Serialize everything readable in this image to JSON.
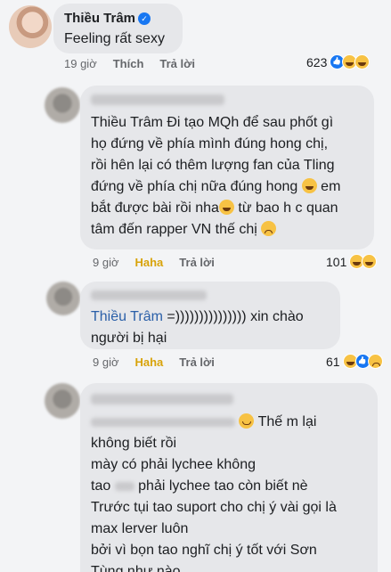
{
  "top_comment": {
    "author": "Thiều Trâm",
    "text": "Feeling rất sexy",
    "time": "19 giờ",
    "like_label": "Thích",
    "reply_label": "Trả lời",
    "reaction_count": "623",
    "reaction_icons": [
      "like-icon",
      "haha-icon",
      "haha-icon"
    ]
  },
  "reply1": {
    "lines": [
      "Thiều Trâm Đi tạo MQh để sau phốt gì",
      "họ đứng về phía mình đúng hong chị,",
      "rồi hên lại có thêm lượng fan của Tling",
      "đứng về phía chị nữa đúng hong",
      "em",
      "bắt được bài rồi nha",
      "từ bao h c quan",
      "tâm đến rapper VN thế chị"
    ],
    "time": "9 giờ",
    "reaction_label": "Haha",
    "reply_label": "Trả lời",
    "reaction_count": "101"
  },
  "reply2": {
    "mention": "Thiều Trâm",
    "line1": " =)))))))))))))))  xin chào",
    "line2": "người bị hại",
    "time": "9 giờ",
    "reaction_label": "Haha",
    "reply_label": "Trả lời",
    "reaction_count": "61"
  },
  "reply3": {
    "line1_tail": "Thế m lại",
    "lines": [
      "không biết rồi",
      "mày có phải lychee không",
      "tao",
      "phải lychee tao còn biết nè",
      "Trước tụi tao suport cho chị ý vài gọi là",
      "max lerver luôn",
      "bởi vì bọn tao nghĩ chị ý tốt với Sơn",
      "Tùng như nào"
    ]
  }
}
